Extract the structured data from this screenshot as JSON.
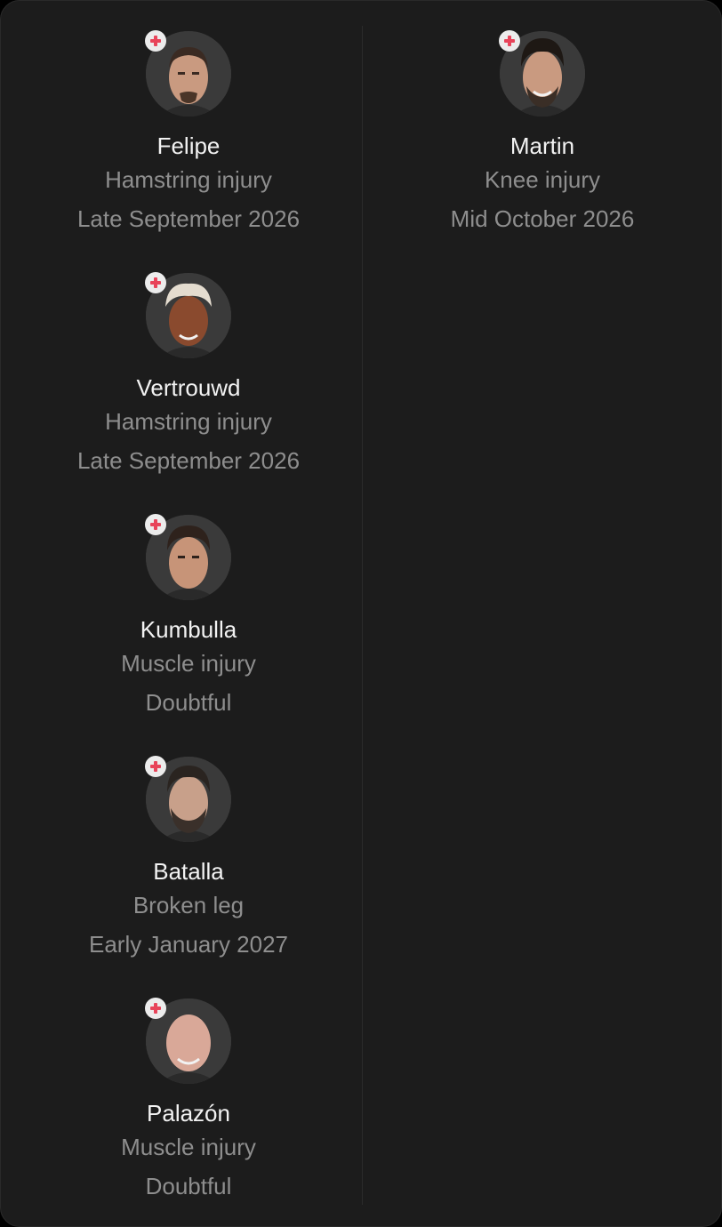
{
  "colors": {
    "background": "#1c1c1c",
    "name_text": "#f2f2f2",
    "detail_text": "#8e8e8e",
    "badge_bg": "#ececec",
    "badge_cross": "#e8445a"
  },
  "columns": [
    {
      "players": [
        {
          "name": "Felipe",
          "injury": "Hamstring injury",
          "return": "Late September 2026",
          "avatar_icon": "player-photo",
          "badge_icon": "injury-cross-icon"
        },
        {
          "name": "Vertrouwd",
          "injury": "Hamstring injury",
          "return": "Late September 2026",
          "avatar_icon": "player-photo",
          "badge_icon": "injury-cross-icon"
        },
        {
          "name": "Kumbulla",
          "injury": "Muscle injury",
          "return": "Doubtful",
          "avatar_icon": "player-photo",
          "badge_icon": "injury-cross-icon"
        },
        {
          "name": "Batalla",
          "injury": "Broken leg",
          "return": "Early January 2027",
          "avatar_icon": "player-photo",
          "badge_icon": "injury-cross-icon"
        },
        {
          "name": "Palazón",
          "injury": "Muscle injury",
          "return": "Doubtful",
          "avatar_icon": "player-photo",
          "badge_icon": "injury-cross-icon"
        }
      ]
    },
    {
      "players": [
        {
          "name": "Martin",
          "injury": "Knee injury",
          "return": "Mid October 2026",
          "avatar_icon": "player-photo",
          "badge_icon": "injury-cross-icon"
        }
      ]
    }
  ]
}
